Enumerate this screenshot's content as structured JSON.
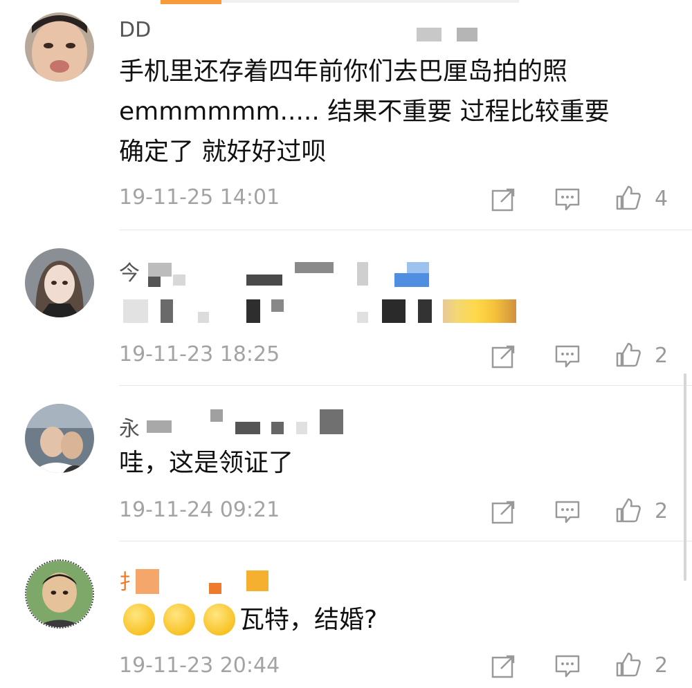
{
  "comments": [
    {
      "name": "DD",
      "lines": [
        "手机里还存着四年前你们去巴厘岛拍的照",
        "emmmmmm..... 结果不重要 过程比较重要",
        "确定了 就好好过呗"
      ],
      "time": "19-11-25 14:01",
      "likes": "4"
    },
    {
      "name": "今",
      "lines": [],
      "time": "19-11-23 18:25",
      "likes": "2"
    },
    {
      "name": "永",
      "lines": [
        "哇，这是领证了"
      ],
      "time": "19-11-24 09:21",
      "likes": "2"
    },
    {
      "name": "扌",
      "lines": [
        "瓦特，结婚?"
      ],
      "time": "19-11-23 20:44",
      "likes": "2"
    }
  ],
  "icons": {
    "repost": "repost-icon",
    "reply": "comment-icon",
    "like": "thumbs-up-icon"
  },
  "colors": {
    "accent": "#f79b3a",
    "text": "#111111",
    "meta": "#a3a3a3",
    "icon": "#9a9a9a",
    "orange_name": "#f07c2a"
  }
}
